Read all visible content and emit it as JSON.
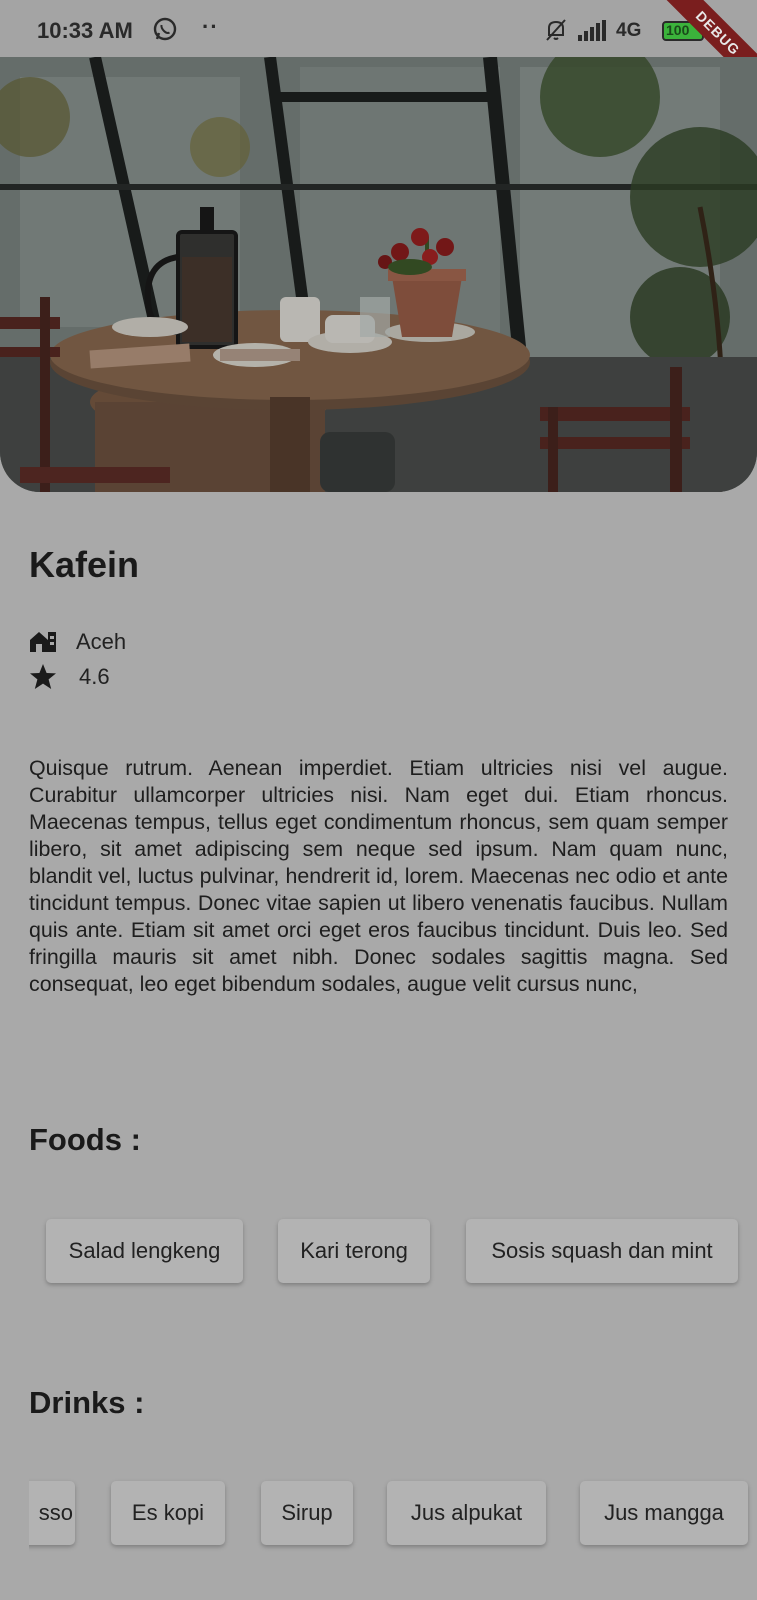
{
  "status_bar": {
    "time": "10:33 AM",
    "dots": "··",
    "network": "4G",
    "battery": "100",
    "debug_label": "DEBUG"
  },
  "place": {
    "name": "Kafein",
    "location": "Aceh",
    "rating": "4.6",
    "description": "Quisque rutrum. Aenean imperdiet. Etiam ultricies nisi vel augue. Curabitur ullamcorper ultricies nisi. Nam eget dui. Etiam rhoncus. Maecenas tempus, tellus eget condimentum rhoncus, sem quam semper libero, sit amet adipiscing sem neque sed ipsum. Nam quam nunc, blandit vel, luctus pulvinar, hendrerit id, lorem. Maecenas nec odio et ante tincidunt tempus. Donec vitae sapien ut libero venenatis faucibus. Nullam quis ante. Etiam sit amet orci eget eros faucibus tincidunt. Duis leo. Sed fringilla mauris sit amet nibh. Donec sodales sagittis magna. Sed consequat, leo eget bibendum sodales, augue velit cursus nunc,"
  },
  "foods": {
    "title": "Foods :",
    "items": [
      "Salad lengkeng",
      "Kari terong",
      "Sosis squash dan mint"
    ]
  },
  "drinks": {
    "title": "Drinks :",
    "items": [
      "sso",
      "Es kopi",
      "Sirup",
      "Jus alpukat",
      "Jus mangga"
    ]
  },
  "icons": {
    "location": "building-icon",
    "rating": "star-icon",
    "messaging": "whatsapp-icon",
    "mute": "bell-off-icon",
    "signal": "signal-icon",
    "battery": "battery-icon",
    "charging": "lightning-icon"
  },
  "colors": {
    "background": "#a9a9a9",
    "chip": "#b3b3b3",
    "text": "#1a1a1a",
    "debug_banner": "#7a1e1e",
    "battery_fill": "#3bb33b"
  }
}
